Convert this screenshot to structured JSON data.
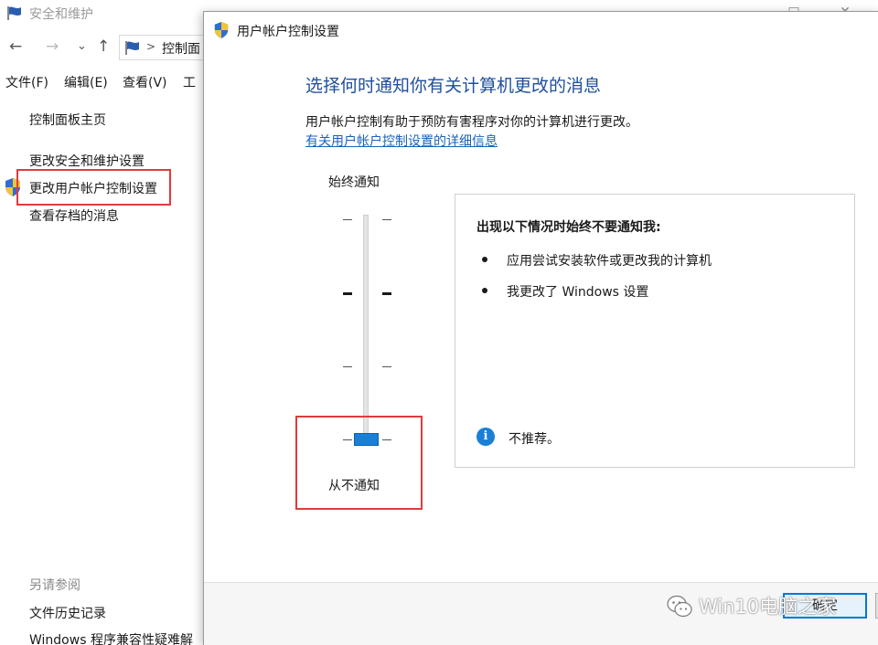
{
  "background_window": {
    "title": "安全和维护",
    "controls": {
      "minimize": "—",
      "maximize": "□",
      "close": "✕"
    },
    "nav": {
      "back": "←",
      "forward": "→",
      "dropdown": "⌄",
      "up": "↑"
    },
    "breadcrumb": {
      "separator": ">",
      "text": "控制面"
    },
    "menu": [
      "文件(F)",
      "编辑(E)",
      "查看(V)",
      "工"
    ],
    "sidebar": {
      "home": "控制面板主页",
      "change_security": "更改安全和维护设置",
      "change_uac": "更改用户帐户控制设置",
      "archived_messages": "查看存档的消息",
      "see_also": "另请参阅",
      "file_history": "文件历史记录",
      "compat": "Windows 程序兼容性疑难解"
    }
  },
  "dialog": {
    "title": "用户帐户控制设置",
    "heading": "选择何时通知你有关计算机更改的消息",
    "description": "用户帐户控制有助于预防有害程序对你的计算机进行更改。",
    "link": "有关用户帐户控制设置的详细信息",
    "slider": {
      "top_label": "始终通知",
      "bottom_label": "从不通知",
      "levels": 4,
      "selected_level": 0
    },
    "info": {
      "heading": "出现以下情况时始终不要通知我:",
      "items": [
        "应用尝试安装软件或更改我的计算机",
        "我更改了 Windows 设置"
      ],
      "note": "不推荐。"
    },
    "ok_label": "确定"
  },
  "watermark": {
    "text": "Win10电脑之家"
  },
  "colors": {
    "heading": "#1f4f9c",
    "link": "#1a62b8",
    "accent": "#1a7fd6",
    "highlight": "#e03b3b"
  }
}
